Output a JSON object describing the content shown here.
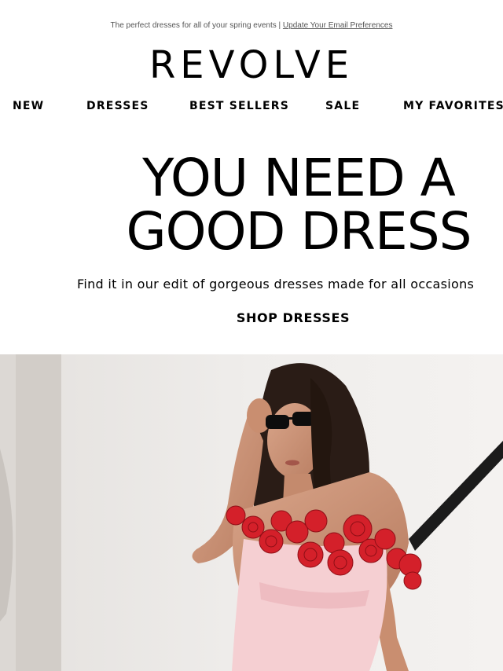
{
  "preheader": {
    "text": "The perfect dresses for all of your spring events |",
    "link": "Update Your Email Preferences"
  },
  "brand": {
    "logo_text": "REVOLVE"
  },
  "nav": {
    "items": [
      {
        "label": "NEW"
      },
      {
        "label": "DRESSES"
      },
      {
        "label": "BEST SELLERS"
      },
      {
        "label": "SALE"
      },
      {
        "label": "MY FAVORITES"
      }
    ]
  },
  "hero": {
    "headline_line1": "YOU NEED A",
    "headline_line2": "GOOD DRESS",
    "subheadline": "Find it in our edit of gorgeous dresses made for all occasions",
    "cta_label": "SHOP DRESSES"
  },
  "colors": {
    "dress_pink": "#f5cfd2",
    "rose_red": "#d4202a",
    "background": "#ffffff"
  }
}
